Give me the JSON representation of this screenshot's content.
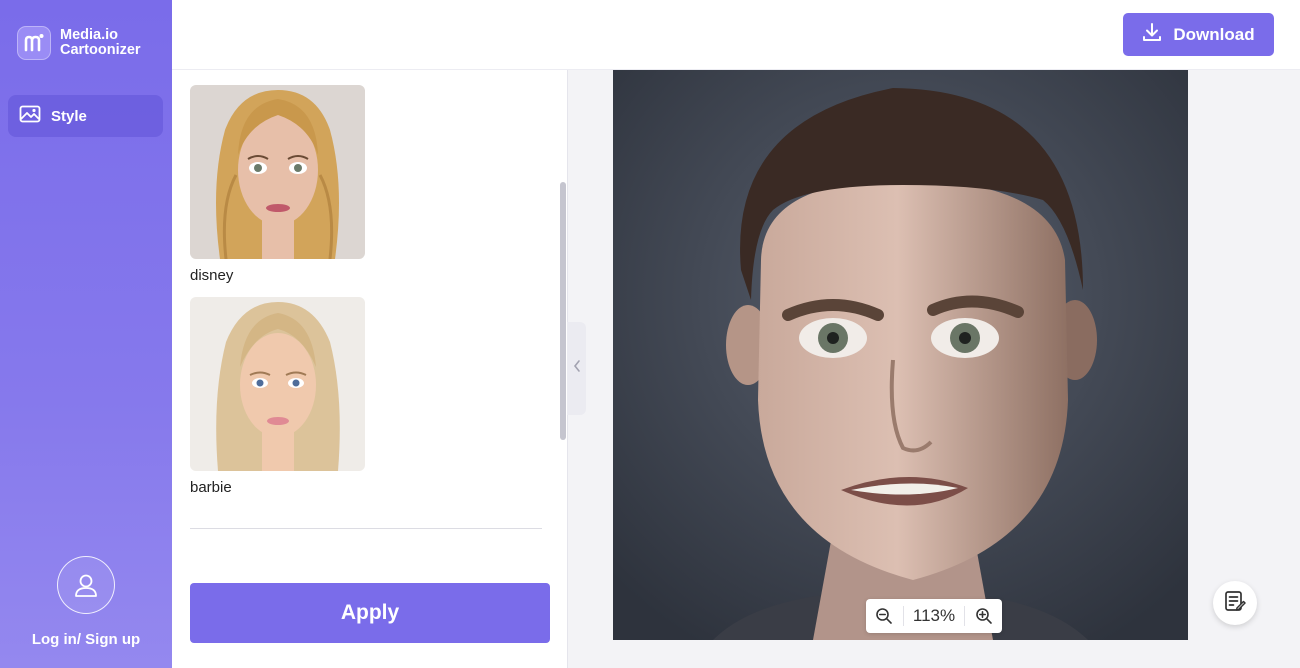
{
  "brand": {
    "name_line1": "Media.io",
    "name_line2": "Cartoonizer",
    "logo_icon": "media-io-logo"
  },
  "sidebar": {
    "nav_style_label": "Style",
    "nav_style_icon": "image-icon",
    "login_label": "Log in/ Sign up",
    "login_icon": "user-icon"
  },
  "toolbar": {
    "download_label": "Download",
    "download_icon": "download-icon"
  },
  "styles": [
    {
      "label": "disney"
    },
    {
      "label": "barbie"
    }
  ],
  "panel": {
    "apply_label": "Apply"
  },
  "zoom": {
    "value": "113%",
    "zoom_out_icon": "zoom-out-icon",
    "zoom_in_icon": "zoom-in-icon"
  },
  "colors": {
    "accent": "#7A6CEA",
    "sidebar": "#8679EC"
  }
}
